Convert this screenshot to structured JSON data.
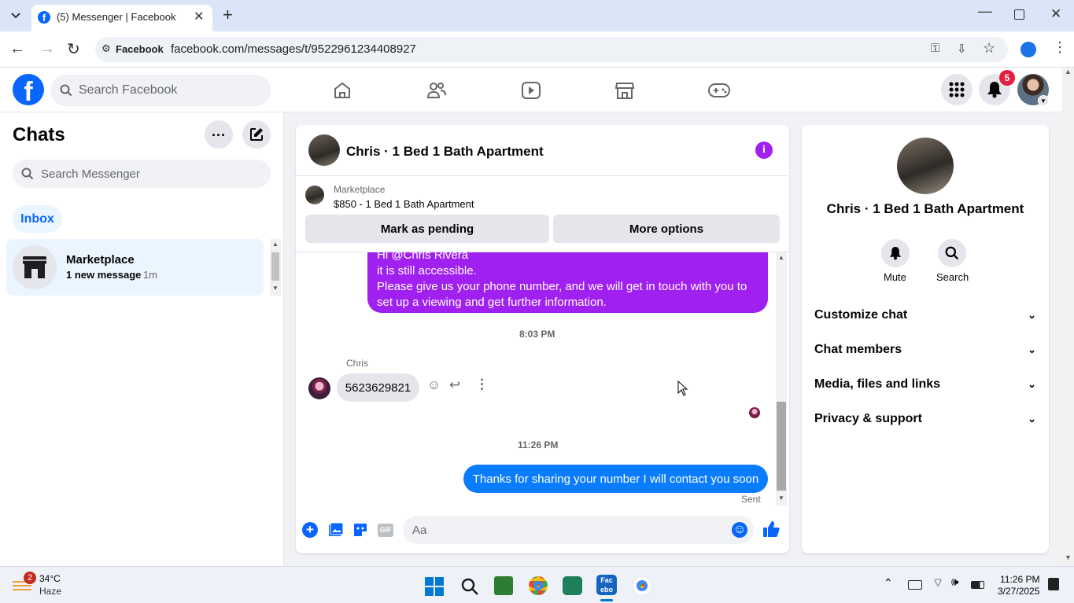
{
  "browser": {
    "tab_title": "(5) Messenger | Facebook",
    "site_chip": "Facebook",
    "url": "facebook.com/messages/t/9522961234408927"
  },
  "fbnav": {
    "search_placeholder": "Search Facebook",
    "notifications_count": "5"
  },
  "chats": {
    "title": "Chats",
    "search_placeholder": "Search Messenger",
    "filter_inbox": "Inbox",
    "items": [
      {
        "name": "Marketplace",
        "preview": "1 new message",
        "time": "· 1m"
      }
    ]
  },
  "conversation": {
    "title": "Chris · 1 Bed 1 Bath Apartment",
    "listing_label": "Marketplace",
    "listing_title": "$850 - 1 Bed 1 Bath Apartment",
    "mark_pending": "Mark as pending",
    "more_options": "More options",
    "messages": {
      "outgoing_1_line0": "Hi @Chris Rivera",
      "outgoing_1_line1": "it is still accessible.",
      "outgoing_1_line2": "Please give us your phone number, and we will get in touch with you to",
      "outgoing_1_line3": "set up a viewing and get further information.",
      "time_1": "8:03 PM",
      "sender_name": "Chris",
      "incoming_1": "5623629821",
      "time_2": "11:26 PM",
      "outgoing_2": "Thanks for sharing your number I will contact you soon",
      "status": "Sent"
    },
    "composer_placeholder": "Aa"
  },
  "info_panel": {
    "name": "Chris · 1 Bed 1 Bath Apartment",
    "mute_label": "Mute",
    "search_label": "Search",
    "sections": [
      "Customize chat",
      "Chat members",
      "Media, files and links",
      "Privacy & support"
    ]
  },
  "taskbar": {
    "weather_temp": "34°C",
    "weather_desc": "Haze",
    "weather_badge": "2",
    "time": "11:26 PM",
    "date": "3/27/2025"
  },
  "colors": {
    "fb_blue": "#0866ff",
    "messenger_purple": "#a020f0",
    "outgoing_blue": "#0a7cff",
    "badge_red": "#e41e3f"
  }
}
